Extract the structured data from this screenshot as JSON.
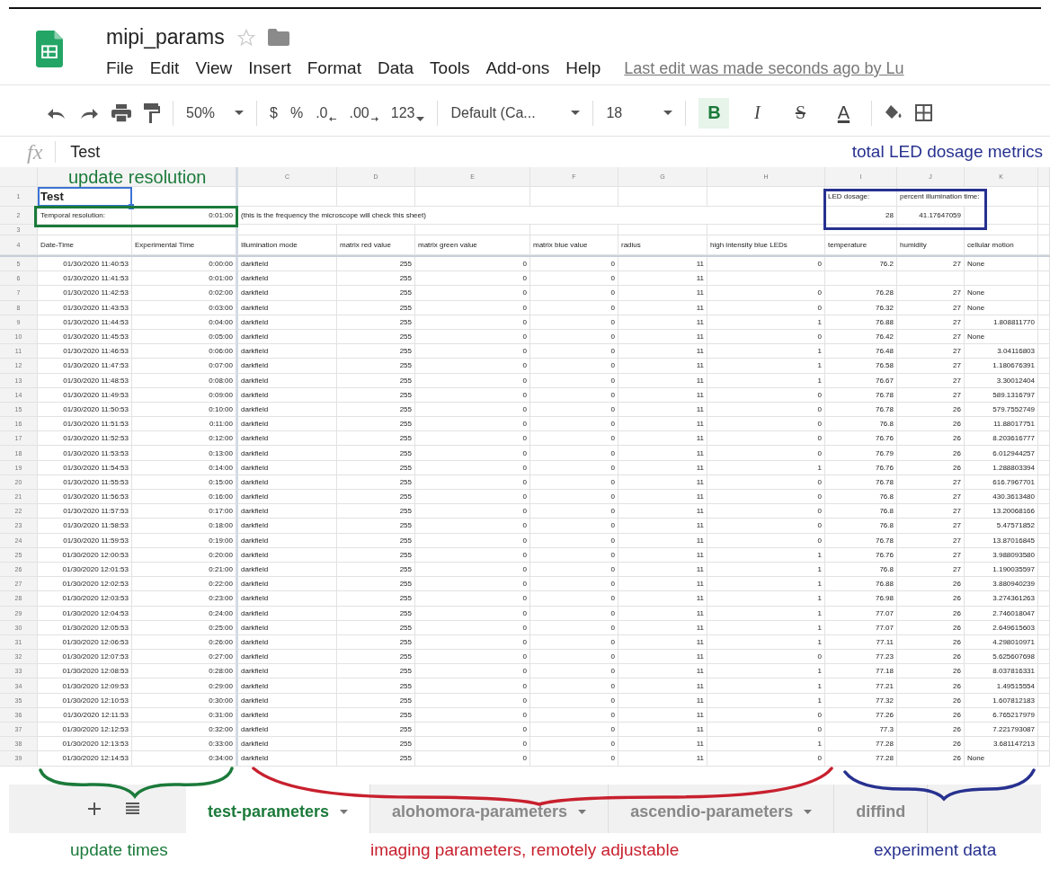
{
  "document": {
    "title": "mipi_params",
    "menus": [
      "File",
      "Edit",
      "View",
      "Insert",
      "Format",
      "Data",
      "Tools",
      "Add-ons",
      "Help"
    ],
    "last_edit": "Last edit was made seconds ago by Lu"
  },
  "toolbar": {
    "zoom": "50%",
    "currency": "$",
    "percent": "%",
    "decrease_decimals": ".0",
    "increase_decimals": ".00",
    "number_format": "123",
    "font": "Default (Ca...",
    "font_size": "18",
    "format_buttons": [
      {
        "label": "B",
        "kind": "bold",
        "selected": true
      },
      {
        "label": "I",
        "kind": "italic",
        "selected": false
      },
      {
        "label": "S",
        "kind": "strike",
        "selected": false
      },
      {
        "label": "A",
        "kind": "color",
        "selected": false
      }
    ]
  },
  "formula_bar": {
    "fx": "fx",
    "value": "Test"
  },
  "top_annotations": [
    {
      "text": "update resolution",
      "color": "#1b7a3a"
    },
    {
      "text": "total LED dosage metrics",
      "color": "#27318f"
    }
  ],
  "sheet": {
    "column_letters": [
      "C",
      "D",
      "E",
      "F",
      "G",
      "H",
      "I",
      "J",
      "K"
    ],
    "top_rows": [
      {
        "n": "1",
        "cells": {
          "A": "Test",
          "I": "LED dosage:",
          "J": "percent illumination time:"
        }
      },
      {
        "n": "2",
        "cells": {
          "A": "Temporal resolution:",
          "B": "0:01:00",
          "C": "(this is the frequency the microscope will check this sheet)",
          "I": "28",
          "J": "41.17647059"
        }
      },
      {
        "n": "3",
        "cells": {}
      }
    ],
    "header_row": {
      "n": "4",
      "cells": [
        "Date-Time",
        "Experimental Time",
        "Illumination mode",
        "matrix red value",
        "matrix green value",
        "matrix blue value",
        "radius",
        "high intensity blue LEDs",
        "temperature",
        "humidity",
        "cellular motion"
      ]
    },
    "rows": [
      {
        "n": "5",
        "cells": [
          "01/30/2020 11:40:53",
          "0:00:00",
          "darkfield",
          "255",
          "0",
          "0",
          "11",
          "0",
          "76.2",
          "27",
          "None"
        ]
      },
      {
        "n": "6",
        "cells": [
          "01/30/2020 11:41:53",
          "0:01:00",
          "darkfield",
          "255",
          "0",
          "0",
          "11"
        ]
      },
      {
        "n": "7",
        "cells": [
          "01/30/2020 11:42:53",
          "0:02:00",
          "darkfield",
          "255",
          "0",
          "0",
          "11",
          "0",
          "76.28",
          "27",
          "None"
        ]
      },
      {
        "n": "8",
        "cells": [
          "01/30/2020 11:43:53",
          "0:03:00",
          "darkfield",
          "255",
          "0",
          "0",
          "11",
          "0",
          "76.32",
          "27",
          "None"
        ]
      },
      {
        "n": "9",
        "cells": [
          "01/30/2020 11:44:53",
          "0:04:00",
          "darkfield",
          "255",
          "0",
          "0",
          "11",
          "1",
          "76.88",
          "27",
          "1.808811770"
        ]
      },
      {
        "n": "10",
        "cells": [
          "01/30/2020 11:45:53",
          "0:05:00",
          "darkfield",
          "255",
          "0",
          "0",
          "11",
          "0",
          "76.42",
          "27",
          "None"
        ]
      },
      {
        "n": "11",
        "cells": [
          "01/30/2020 11:46:53",
          "0:06:00",
          "darkfield",
          "255",
          "0",
          "0",
          "11",
          "1",
          "76.48",
          "27",
          "3.04116803"
        ]
      },
      {
        "n": "12",
        "cells": [
          "01/30/2020 11:47:53",
          "0:07:00",
          "darkfield",
          "255",
          "0",
          "0",
          "11",
          "1",
          "76.58",
          "27",
          "1.180676391"
        ]
      },
      {
        "n": "13",
        "cells": [
          "01/30/2020 11:48:53",
          "0:08:00",
          "darkfield",
          "255",
          "0",
          "0",
          "11",
          "1",
          "76.67",
          "27",
          "3.30012404"
        ]
      },
      {
        "n": "14",
        "cells": [
          "01/30/2020 11:49:53",
          "0:09:00",
          "darkfield",
          "255",
          "0",
          "0",
          "11",
          "0",
          "76.78",
          "27",
          "589.1316797"
        ]
      },
      {
        "n": "15",
        "cells": [
          "01/30/2020 11:50:53",
          "0:10:00",
          "darkfield",
          "255",
          "0",
          "0",
          "11",
          "0",
          "76.78",
          "26",
          "579.7552749"
        ]
      },
      {
        "n": "16",
        "cells": [
          "01/30/2020 11:51:53",
          "0:11:00",
          "darkfield",
          "255",
          "0",
          "0",
          "11",
          "0",
          "76.8",
          "26",
          "11.88017751"
        ]
      },
      {
        "n": "17",
        "cells": [
          "01/30/2020 11:52:53",
          "0:12:00",
          "darkfield",
          "255",
          "0",
          "0",
          "11",
          "0",
          "76.76",
          "26",
          "8.203616777"
        ]
      },
      {
        "n": "18",
        "cells": [
          "01/30/2020 11:53:53",
          "0:13:00",
          "darkfield",
          "255",
          "0",
          "0",
          "11",
          "0",
          "76.79",
          "26",
          "6.012944257"
        ]
      },
      {
        "n": "19",
        "cells": [
          "01/30/2020 11:54:53",
          "0:14:00",
          "darkfield",
          "255",
          "0",
          "0",
          "11",
          "1",
          "76.76",
          "26",
          "1.288803394"
        ]
      },
      {
        "n": "20",
        "cells": [
          "01/30/2020 11:55:53",
          "0:15:00",
          "darkfield",
          "255",
          "0",
          "0",
          "11",
          "0",
          "76.78",
          "27",
          "616.7967701"
        ]
      },
      {
        "n": "21",
        "cells": [
          "01/30/2020 11:56:53",
          "0:16:00",
          "darkfield",
          "255",
          "0",
          "0",
          "11",
          "0",
          "76.8",
          "27",
          "430.3613480"
        ]
      },
      {
        "n": "22",
        "cells": [
          "01/30/2020 11:57:53",
          "0:17:00",
          "darkfield",
          "255",
          "0",
          "0",
          "11",
          "0",
          "76.8",
          "27",
          "13.20068166"
        ]
      },
      {
        "n": "23",
        "cells": [
          "01/30/2020 11:58:53",
          "0:18:00",
          "darkfield",
          "255",
          "0",
          "0",
          "11",
          "0",
          "76.8",
          "27",
          "5.47571852"
        ]
      },
      {
        "n": "24",
        "cells": [
          "01/30/2020 11:59:53",
          "0:19:00",
          "darkfield",
          "255",
          "0",
          "0",
          "11",
          "0",
          "76.78",
          "27",
          "13.87016845"
        ]
      },
      {
        "n": "25",
        "cells": [
          "01/30/2020 12:00:53",
          "0:20:00",
          "darkfield",
          "255",
          "0",
          "0",
          "11",
          "1",
          "76.76",
          "27",
          "3.988093580"
        ]
      },
      {
        "n": "26",
        "cells": [
          "01/30/2020 12:01:53",
          "0:21:00",
          "darkfield",
          "255",
          "0",
          "0",
          "11",
          "1",
          "76.8",
          "27",
          "1.190035597"
        ]
      },
      {
        "n": "27",
        "cells": [
          "01/30/2020 12:02:53",
          "0:22:00",
          "darkfield",
          "255",
          "0",
          "0",
          "11",
          "1",
          "76.88",
          "26",
          "3.880940239"
        ]
      },
      {
        "n": "28",
        "cells": [
          "01/30/2020 12:03:53",
          "0:23:00",
          "darkfield",
          "255",
          "0",
          "0",
          "11",
          "1",
          "76.98",
          "26",
          "3.274361263"
        ]
      },
      {
        "n": "29",
        "cells": [
          "01/30/2020 12:04:53",
          "0:24:00",
          "darkfield",
          "255",
          "0",
          "0",
          "11",
          "1",
          "77.07",
          "26",
          "2.746018047"
        ]
      },
      {
        "n": "30",
        "cells": [
          "01/30/2020 12:05:53",
          "0:25:00",
          "darkfield",
          "255",
          "0",
          "0",
          "11",
          "1",
          "77.07",
          "26",
          "2.649615603"
        ]
      },
      {
        "n": "31",
        "cells": [
          "01/30/2020 12:06:53",
          "0:26:00",
          "darkfield",
          "255",
          "0",
          "0",
          "11",
          "1",
          "77.11",
          "26",
          "4.298010971"
        ]
      },
      {
        "n": "32",
        "cells": [
          "01/30/2020 12:07:53",
          "0:27:00",
          "darkfield",
          "255",
          "0",
          "0",
          "11",
          "0",
          "77.23",
          "26",
          "5.625607698"
        ]
      },
      {
        "n": "33",
        "cells": [
          "01/30/2020 12:08:53",
          "0:28:00",
          "darkfield",
          "255",
          "0",
          "0",
          "11",
          "1",
          "77.18",
          "26",
          "8.037816331"
        ]
      },
      {
        "n": "34",
        "cells": [
          "01/30/2020 12:09:53",
          "0:29:00",
          "darkfield",
          "255",
          "0",
          "0",
          "11",
          "1",
          "77.21",
          "26",
          "1.49515554"
        ]
      },
      {
        "n": "35",
        "cells": [
          "01/30/2020 12:10:53",
          "0:30:00",
          "darkfield",
          "255",
          "0",
          "0",
          "11",
          "1",
          "77.32",
          "26",
          "1.607812183"
        ]
      },
      {
        "n": "36",
        "cells": [
          "01/30/2020 12:11:53",
          "0:31:00",
          "darkfield",
          "255",
          "0",
          "0",
          "11",
          "0",
          "77.26",
          "26",
          "6.765217979"
        ]
      },
      {
        "n": "37",
        "cells": [
          "01/30/2020 12:12:53",
          "0:32:00",
          "darkfield",
          "255",
          "0",
          "0",
          "11",
          "0",
          "77.3",
          "26",
          "7.221793087"
        ]
      },
      {
        "n": "38",
        "cells": [
          "01/30/2020 12:13:53",
          "0:33:00",
          "darkfield",
          "255",
          "0",
          "0",
          "11",
          "1",
          "77.28",
          "26",
          "3.681147213"
        ]
      },
      {
        "n": "39",
        "cells": [
          "01/30/2020 12:14:53",
          "0:34:00",
          "darkfield",
          "255",
          "0",
          "0",
          "11",
          "0",
          "77.28",
          "26",
          "None"
        ]
      }
    ]
  },
  "sheet_tabs": [
    {
      "label": "test-parameters",
      "selected": true
    },
    {
      "label": "alohomora-parameters",
      "selected": false
    },
    {
      "label": "ascendio-parameters",
      "selected": false
    },
    {
      "label": "diffind",
      "selected": false
    }
  ],
  "bottom_annotations": [
    {
      "text": "update times",
      "color": "#1b7a3a"
    },
    {
      "text": "imaging parameters, remotely adjustable",
      "color": "#c8202e"
    },
    {
      "text": "experiment data",
      "color": "#27318f"
    }
  ]
}
